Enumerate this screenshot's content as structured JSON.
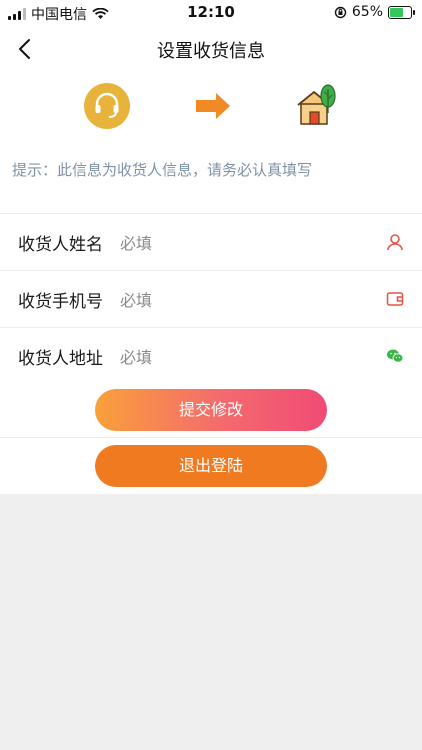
{
  "status_bar": {
    "carrier": "中国电信",
    "time": "12:10",
    "battery": "65%"
  },
  "nav": {
    "title": "设置收货信息"
  },
  "flow": {
    "icons": [
      "customer-service-icon",
      "arrow-right-icon",
      "house-icon"
    ]
  },
  "tip": {
    "text": "提示：此信息为收货人信息，请务必认真填写"
  },
  "form": {
    "fields": [
      {
        "label": "收货人姓名",
        "placeholder": "必填",
        "icon": "person-icon"
      },
      {
        "label": "收货手机号",
        "placeholder": "必填",
        "icon": "wallet-icon"
      },
      {
        "label": "收货人地址",
        "placeholder": "必填",
        "icon": "wechat-icon"
      }
    ]
  },
  "buttons": {
    "submit": "提交修改",
    "logout": "退出登陆"
  },
  "colors": {
    "accent_gold": "#e8b33a",
    "arrow_orange": "#f08a24",
    "icon_red": "#e2574c",
    "icon_green": "#3ab54a",
    "submit_gradient_start": "#f9a03a",
    "submit_gradient_end": "#f04b74",
    "logout": "#f07a20",
    "tip_text": "#7f93a8"
  }
}
